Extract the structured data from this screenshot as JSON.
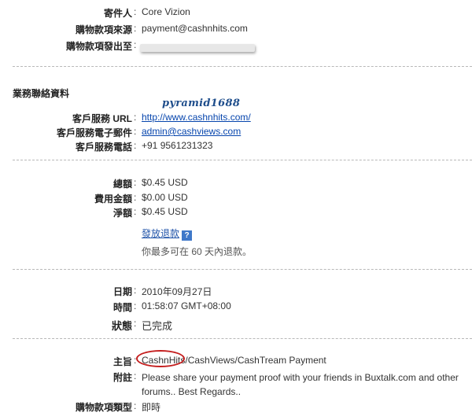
{
  "sender": {
    "label": "寄件人",
    "value": "Core Vizion"
  },
  "source": {
    "label": "購物款項來源",
    "value": "payment@cashnhits.com"
  },
  "destination": {
    "label": "購物款項發出至"
  },
  "business_contact": {
    "title": "業務聯絡資料",
    "watermark": "pyramid1688",
    "url_label": "客戶服務 URL",
    "url_value": "http://www.cashnhits.com/",
    "email_label": "客戶服務電子郵件",
    "email_value": "admin@cashviews.com",
    "phone_label": "客戶服務電話",
    "phone_value": "+91 9561231323"
  },
  "amounts": {
    "total_label": "總額",
    "total_value": "$0.45 USD",
    "fee_label": "費用金額",
    "fee_value": "$0.00 USD",
    "net_label": "淨額",
    "net_value": "$0.45 USD",
    "refund_link": "發放退款",
    "help_icon": "?",
    "refund_note": "你最多可在 60 天內退款。"
  },
  "timing": {
    "date_label": "日期",
    "date_value": "2010年09月27日",
    "time_label": "時間",
    "time_value": "01:58:07 GMT+08:00",
    "status_label": "狀態",
    "status_value": "已完成"
  },
  "details": {
    "subject_label": "主旨",
    "subject_value": "CashnHits/CashViews/CashTream Payment",
    "memo_label": "附註",
    "memo_value": "Please share your payment proof with your friends in Buxtalk.com and other forums.. Best Regards..",
    "type_label": "購物款項類型",
    "type_value": "即時"
  },
  "colors": {
    "link": "#0645ad",
    "highlight_circle": "#c41e1e"
  }
}
